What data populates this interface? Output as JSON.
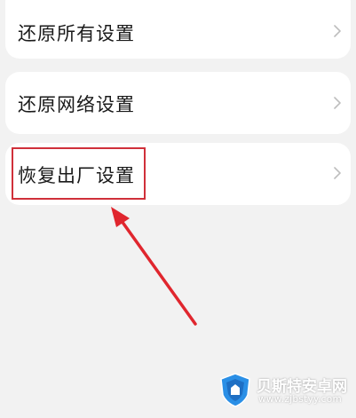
{
  "settings": {
    "items": [
      {
        "label": "还原所有设置",
        "icon": "chevron-right-icon"
      },
      {
        "label": "还原网络设置",
        "icon": "chevron-right-icon"
      },
      {
        "label": "恢复出厂设置",
        "icon": "chevron-right-icon"
      }
    ]
  },
  "annotation": {
    "highlight_color": "#d0303a",
    "arrow_color": "#e0262e"
  },
  "watermark": {
    "brand": "贝斯特安卓网",
    "url": "www.zjbstyy.com"
  }
}
